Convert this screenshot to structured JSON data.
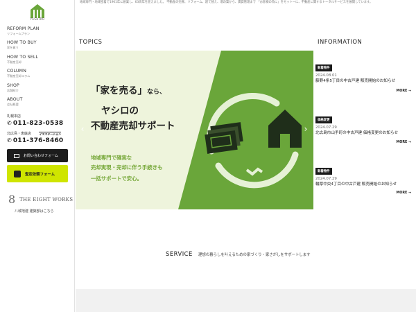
{
  "brand": {
    "logo_text": "YASHIRO",
    "logo_icon": "house-stripes-icon"
  },
  "sidebar": {
    "nav": [
      {
        "en": "REFORM PLAN",
        "jp": "リフォームプラン"
      },
      {
        "en": "HOW TO BUY",
        "jp": "家を買う"
      },
      {
        "en": "HOW TO SELL",
        "jp": "不動産売却"
      },
      {
        "en": "COLUMN",
        "jp": "不動産売却コラム"
      },
      {
        "en": "SHOP",
        "jp": "店舗紹介"
      },
      {
        "en": "ABOUT",
        "jp": "会社概要"
      }
    ],
    "store1": "札幌本店",
    "phone1": "011-823-0538",
    "store2": "北広島・恵庭店",
    "store2_tag": "イエステーション",
    "phone2": "011-376-8460",
    "contact_button": "お問い合わせフォーム",
    "appraisal_button": "査定依頼フォーム",
    "eight_name": "THE EIGHT WORKS",
    "eight_sub": "八城地建 建築部はこちら"
  },
  "intro_text": "地域専門・地域密着で1961年に創業し、63周年を迎えました。 不動産の売買、リフォーム、建て替え、增改築から、賃貸管理まで 「お客様の為に」をモットーに、不動産に関するトータルサービスを展開しています。",
  "topics": {
    "heading": "TOPICS",
    "slide": {
      "line1": "「家を売る」",
      "line1_suffix": "なら、",
      "line2": "ヤシロの",
      "line3": "不動産売却サポート",
      "sub1": "地域専門で確実な",
      "sub2": "売却実現・売却に伴う手続きも",
      "sub3": "一括サポートで安心。"
    },
    "prev_arrow": "‹",
    "next_arrow": "›"
  },
  "information": {
    "heading": "INFORMATION",
    "items": [
      {
        "badge": "新着物件",
        "date": "2024.08.01",
        "text": "藤野4条5丁目の中古戸建 販売開始のお知らせ",
        "more": "MORE →"
      },
      {
        "badge": "価格変更",
        "date": "2024.07.29",
        "text": "北広島市山手町の中古戸建 価格変更のお知らせ",
        "more": "MORE →"
      },
      {
        "badge": "新着物件",
        "date": "2024.07.29",
        "text": "輪厚中央4丁目の中古戸建 販売開始のお知らせ",
        "more": "MORE →"
      }
    ]
  },
  "service": {
    "heading": "SERVICE",
    "sub": "理想の暮らしを叶えるための家づくり・家さがしをサポートします"
  },
  "colors": {
    "accent_green": "#6aa63a",
    "lime": "#cfe500",
    "dark": "#1c1c1c"
  }
}
